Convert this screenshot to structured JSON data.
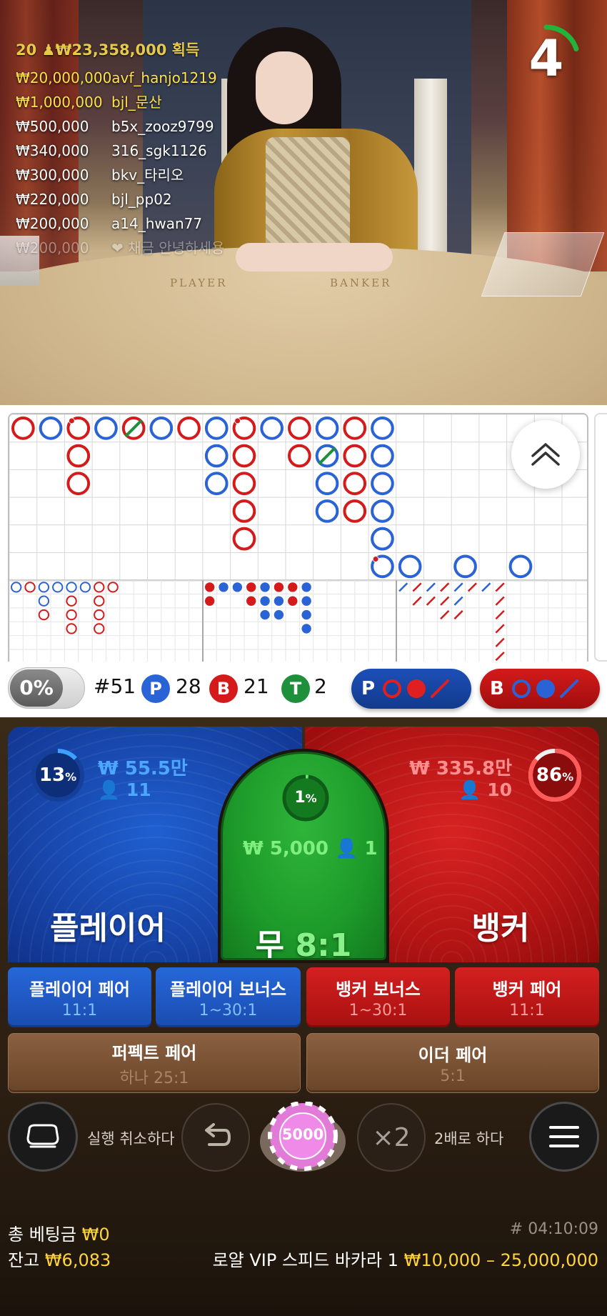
{
  "feed": {
    "header": "20 ♟₩23,358,000 획득",
    "rows": [
      {
        "amount": "₩20,000,000",
        "user": "avf_hanjo1219",
        "style": "gold"
      },
      {
        "amount": "₩1,000,000",
        "user": "bjl_문산",
        "style": "gold"
      },
      {
        "amount": "₩500,000",
        "user": "b5x_zooz9799",
        "style": ""
      },
      {
        "amount": "₩340,000",
        "user": "316_sgk1126",
        "style": ""
      },
      {
        "amount": "₩300,000",
        "user": "bkv_타리오",
        "style": ""
      },
      {
        "amount": "₩220,000",
        "user": "bjl_pp02",
        "style": ""
      },
      {
        "amount": "₩200,000",
        "user": "a14_hwan77",
        "style": ""
      },
      {
        "amount": "₩200,000",
        "user": "❤ 채금 안녕하세용",
        "style": "faded"
      }
    ]
  },
  "table": {
    "player_word": "PLAYER",
    "banker_word": "BANKER"
  },
  "timer": {
    "value": "4",
    "progress": 0.2
  },
  "stats": {
    "percent": "0%",
    "round": "#51",
    "player_letter": "P",
    "player_count": "28",
    "banker_letter": "B",
    "banker_count": "21",
    "tie_letter": "T",
    "tie_count": "2",
    "ask_player": "P",
    "ask_banker": "B"
  },
  "colors": {
    "player": "#2a63d6",
    "banker": "#d41a1a",
    "tie": "#1e8f3a",
    "gold": "#ffd43a"
  },
  "bigroad": {
    "cols": 21,
    "rows": 6,
    "columns": [
      [
        "B"
      ],
      [
        "P"
      ],
      [
        "B",
        "B",
        "B"
      ],
      [
        "P"
      ],
      [
        "B"
      ],
      [
        "P"
      ],
      [
        "B"
      ],
      [
        "P",
        "P",
        "P"
      ],
      [
        "B",
        "B",
        "B",
        "B",
        "B"
      ],
      [
        "P"
      ],
      [
        "B",
        "B"
      ],
      [
        "P",
        "P",
        "P",
        "P"
      ],
      [
        "B",
        "B",
        "B",
        "B"
      ],
      [
        "P",
        "P",
        "P",
        "P",
        "P",
        "P"
      ],
      [
        "P"
      ],
      [
        "P"
      ],
      [
        "P"
      ]
    ],
    "tie_marks": [
      [
        4,
        0
      ],
      [
        11,
        1
      ]
    ],
    "pair_marks": [
      [
        2,
        0
      ],
      [
        8,
        0
      ],
      [
        13,
        5
      ]
    ]
  },
  "player_zone": {
    "label": "플레이어",
    "percent": "13",
    "amount": "₩ 55.5만",
    "bettors": "11",
    "ratio": 0.13
  },
  "banker_zone": {
    "label": "뱅커",
    "percent": "86",
    "amount": "₩ 335.8만",
    "bettors": "10",
    "ratio": 0.86
  },
  "tie_zone": {
    "label": "무",
    "odds": "8:1",
    "percent": "1",
    "amount": "₩ 5,000",
    "bettors": "1",
    "ratio": 0.01
  },
  "side_bets": [
    {
      "title": "플레이어 페어",
      "odds": "11:1",
      "color": "blue"
    },
    {
      "title": "플레이어 보너스",
      "odds": "1~30:1",
      "color": "blue"
    },
    {
      "title": "뱅커 보너스",
      "odds": "1~30:1",
      "color": "red"
    },
    {
      "title": "뱅커 페어",
      "odds": "11:1",
      "color": "red"
    }
  ],
  "extra_bets": [
    {
      "title": "퍼펙트 페어",
      "odds": "하나 25:1"
    },
    {
      "title": "이더 페어",
      "odds": "5:1"
    }
  ],
  "controls": {
    "undo_label": "실행 취소하다",
    "chip_value": "5000",
    "double_label": "2배로 하다",
    "double_icon": "×2"
  },
  "footer": {
    "total_label": "총 베팅금",
    "total_value": "₩0",
    "balance_label": "잔고",
    "balance_value": "₩6,083",
    "game_id": "# 04:10:09",
    "table_name": "로얄 VIP 스피드 바카라 1",
    "limits": "₩10,000 – 25,000,000"
  }
}
